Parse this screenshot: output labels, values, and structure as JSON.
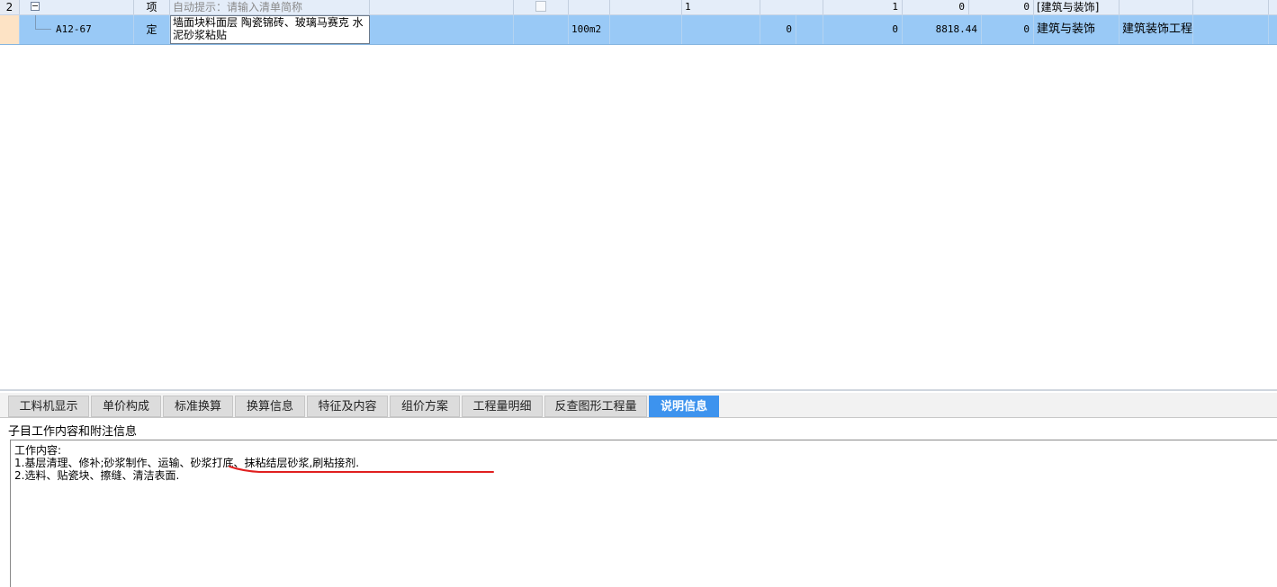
{
  "grid": {
    "row2": {
      "num": "2",
      "type": "项",
      "name_hint": "自动提示：请输入清单简称",
      "c_760": "1",
      "c_990": "1",
      "c_1070": "0",
      "c_1145": "0",
      "specialty": "[建筑与装饰]"
    },
    "row_selected": {
      "code": "A12-67",
      "type": "定",
      "name": "墙面块料面层 陶瓷锦砖、玻璃马赛克 水泥砂浆粘贴",
      "unit": "100m2",
      "c_880": "0",
      "c_995": "0",
      "c_1085": "8818.44",
      "c_1145": "0",
      "specialty": "建筑与装饰",
      "project": "建筑装饰工程"
    }
  },
  "tabs": [
    {
      "label": "工料机显示"
    },
    {
      "label": "单价构成"
    },
    {
      "label": "标准换算"
    },
    {
      "label": "换算信息"
    },
    {
      "label": "特征及内容"
    },
    {
      "label": "组价方案"
    },
    {
      "label": "工程量明细"
    },
    {
      "label": "反查图形工程量"
    },
    {
      "label": "说明信息"
    }
  ],
  "info": {
    "title": "子目工作内容和附注信息",
    "lines": [
      "工作内容:",
      "1.基层清理、修补;砂浆制作、运输、砂浆打底、抹粘结层砂浆,刷粘接剂.",
      "2.选料、贴瓷块、擦缝、清洁表面."
    ]
  },
  "colors": {
    "selected_row": "#99c9f6",
    "active_tab": "#3d93ee",
    "annotation": "#e02020"
  }
}
